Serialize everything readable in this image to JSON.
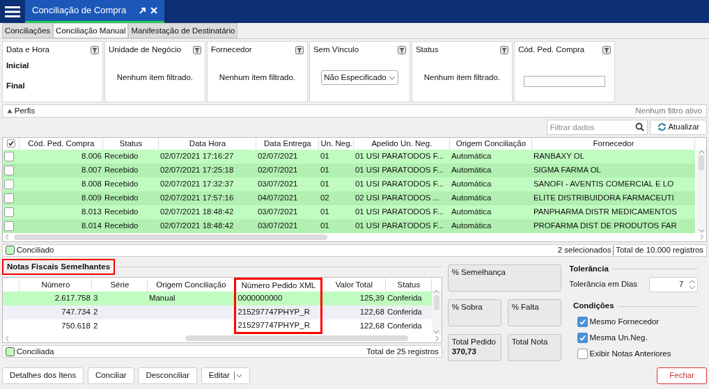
{
  "window": {
    "title": "Conciliação de Compra"
  },
  "tabs": [
    {
      "label": "Conciliações",
      "selected": false
    },
    {
      "label": "Conciliação Manual",
      "selected": true
    },
    {
      "label": "Manifestação de Destinatário",
      "selected": false
    }
  ],
  "filters": [
    {
      "kind": "date",
      "title": "Data e Hora",
      "labels": [
        "Inicial",
        "Final"
      ]
    },
    {
      "kind": "list",
      "title": "Unidade de Negócio",
      "message": "Nenhum item filtrado."
    },
    {
      "kind": "list",
      "title": "Fornecedor",
      "message": "Nenhum item filtrado."
    },
    {
      "kind": "select",
      "title": "Sem Vínculo",
      "value": "Não Especificado"
    },
    {
      "kind": "list",
      "title": "Status",
      "message": "Nenhum item filtrado."
    },
    {
      "kind": "text",
      "title": "Cód. Ped. Compra"
    }
  ],
  "profiles_bar": {
    "label": "Perfis",
    "status": "Nenhum filtro ativo"
  },
  "search": {
    "placeholder": "Filtrar dados"
  },
  "refresh_button": "Atualizar",
  "orders_table": {
    "all_checked": true,
    "columns": [
      {
        "label": "Cód. Ped. Compra",
        "numeric": true,
        "highlighted": false
      },
      {
        "label": "Status",
        "numeric": false,
        "highlighted": false
      },
      {
        "label": "Data Hora",
        "numeric": false,
        "highlighted": false
      },
      {
        "label": "Data Entrega",
        "numeric": false,
        "highlighted": false
      },
      {
        "label": "Un. Neg.",
        "numeric": false,
        "highlighted": false
      },
      {
        "label": "Apelido Un. Neg.",
        "numeric": false,
        "highlighted": false
      },
      {
        "label": "Origem Conciliação",
        "numeric": false,
        "highlighted": false
      },
      {
        "label": "Fornecedor",
        "numeric": false,
        "highlighted": false
      }
    ],
    "rows": [
      {
        "checked": false,
        "conciliated": true,
        "cells": [
          "8.006",
          "Recebido",
          "02/07/2021 17:16:27",
          "02/07/2021",
          "01",
          "01 USI PARATODOS F...",
          "Automática",
          "RANBAXY OL"
        ]
      },
      {
        "checked": false,
        "conciliated": true,
        "cells": [
          "8.007",
          "Recebido",
          "02/07/2021 17:25:18",
          "02/07/2021",
          "01",
          "01 USI PARATODOS F...",
          "Automática",
          "SIGMA FARMA OL"
        ]
      },
      {
        "checked": false,
        "conciliated": true,
        "cells": [
          "8.008",
          "Recebido",
          "02/07/2021 17:32:37",
          "03/07/2021",
          "01",
          "01 USI PARATODOS F...",
          "Automática",
          "SANOFI - AVENTIS COMERCIAL E LO"
        ]
      },
      {
        "checked": false,
        "conciliated": true,
        "cells": [
          "8.009",
          "Recebido",
          "02/07/2021 17:57:16",
          "04/07/2021",
          "02",
          "02 USI PARATODOS ...",
          "Automática",
          "ELITE DISTRIBUIDORA FARMACEUTI"
        ]
      },
      {
        "checked": false,
        "conciliated": true,
        "cells": [
          "8.013",
          "Recebido",
          "02/07/2021 18:48:42",
          "03/07/2021",
          "01",
          "01 USI PARATODOS F...",
          "Automática",
          "PANPHARMA DISTR MEDICAMENTOS"
        ]
      },
      {
        "checked": false,
        "conciliated": true,
        "cells": [
          "8.014",
          "Recebido",
          "02/07/2021 18:48:42",
          "03/07/2021",
          "01",
          "01 USI PARATODOS F...",
          "Automática",
          "PROFARMA DIST DE PRODUTOS FAR"
        ]
      }
    ],
    "legend": "Conciliado",
    "selection_info": "2 selecionados",
    "total": "Total de 10.000 registros"
  },
  "similar_invoices": {
    "title": "Notas Fiscais Semelhantes",
    "highlighted": true,
    "columns": [
      {
        "label": "Número",
        "numeric": true,
        "highlighted": false
      },
      {
        "label": "Série",
        "numeric": false,
        "highlighted": false
      },
      {
        "label": "Origem Conciliação",
        "numeric": false,
        "highlighted": false
      },
      {
        "label": "Número Pedido XML",
        "numeric": false,
        "highlighted": true
      },
      {
        "label": "Valor Total",
        "numeric": true,
        "highlighted": false
      },
      {
        "label": "Status",
        "numeric": false,
        "highlighted": false
      }
    ],
    "rows": [
      {
        "conciliated": true,
        "cells": [
          "2.617.758",
          "3",
          "Manual",
          "0000000000",
          "125,39",
          "Conferida"
        ]
      },
      {
        "conciliated": false,
        "cells": [
          "747.734",
          "2",
          "",
          "215297747PHYP_R",
          "122,68",
          "Conferida"
        ]
      },
      {
        "conciliated": false,
        "cells": [
          "750.618",
          "2",
          "",
          "215297747PHYP_R",
          "122,68",
          "Conferida"
        ]
      }
    ],
    "legend": "Conciliada",
    "total": "Total de 25 registros"
  },
  "stats": [
    {
      "label": "% Semelhança"
    },
    {
      "label": "% Sobra"
    },
    {
      "label": "% Falta"
    },
    {
      "label": "Total Pedido",
      "value": "370,73"
    },
    {
      "label": "Total Nota"
    }
  ],
  "tolerance": {
    "title": "Tolerância",
    "label": "Tolerância em Dias",
    "value": "7"
  },
  "conditions": {
    "title": "Condições",
    "options": [
      {
        "label": "Mesmo Fornecedor",
        "checked": true
      },
      {
        "label": "Mesma Un.Neg.",
        "checked": true
      },
      {
        "label": "Exibir Notas Anteriores",
        "checked": false
      }
    ]
  },
  "buttons": [
    {
      "kind": "plain",
      "label": "Detalhes dos Itens"
    },
    {
      "kind": "plain",
      "label": "Conciliar"
    },
    {
      "kind": "plain",
      "label": "Desconciliar"
    },
    {
      "kind": "split",
      "label": "Editar"
    }
  ],
  "close_button": "Fechar"
}
